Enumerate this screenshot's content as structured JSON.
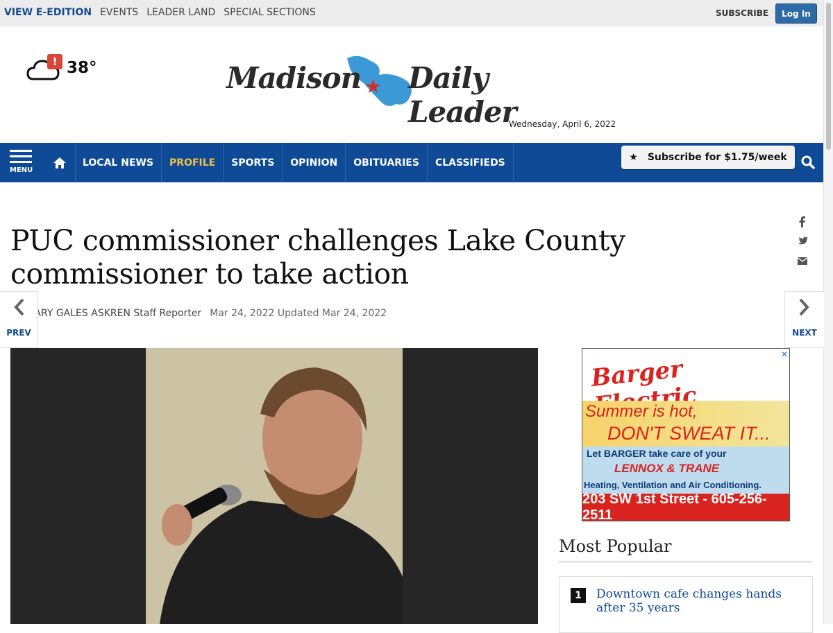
{
  "topbar": {
    "links": [
      "VIEW E-EDITION",
      "EVENTS",
      "LEADER LAND",
      "SPECIAL SECTIONS"
    ],
    "subscribe": "SUBSCRIBE",
    "login": "Log In"
  },
  "weather": {
    "alert": "!",
    "temperature": "38°"
  },
  "masthead": {
    "left": "Madison",
    "right": "Daily Leader"
  },
  "date": "Wednesday, April 6, 2022",
  "nav": {
    "menu": "MENU",
    "items": [
      "LOCAL NEWS",
      "PROFILE",
      "SPORTS",
      "OPINION",
      "OBITUARIES",
      "CLASSIFIEDS"
    ],
    "active": "PROFILE",
    "subscribe_button": "Subscribe for $1.75/week"
  },
  "article": {
    "headline": "PUC commissioner challenges Lake County commissioner to take action",
    "byline": "By MARY GALES ASKREN Staff Reporter",
    "dates": "Mar 24, 2022 Updated Mar 24, 2022"
  },
  "pager": {
    "prev": "PREV",
    "next": "NEXT"
  },
  "ad": {
    "brand": "Barger Electric",
    "line1": "Summer is hot,",
    "line2": "DON'T SWEAT IT...",
    "line3": "Let BARGER take care of your",
    "line4": "LENNOX & TRANE",
    "line5": "Heating, Ventilation and Air Conditioning.",
    "address": "203 SW 1st Street - 605-256-2511"
  },
  "most_popular": {
    "title": "Most Popular",
    "items": [
      {
        "rank": "1",
        "title": "Downtown cafe changes hands after 35 years"
      }
    ]
  },
  "colors": {
    "nav_blue": "#0e4a96",
    "active_nav": "#f1c044",
    "login_blue": "#2d6aa6"
  }
}
